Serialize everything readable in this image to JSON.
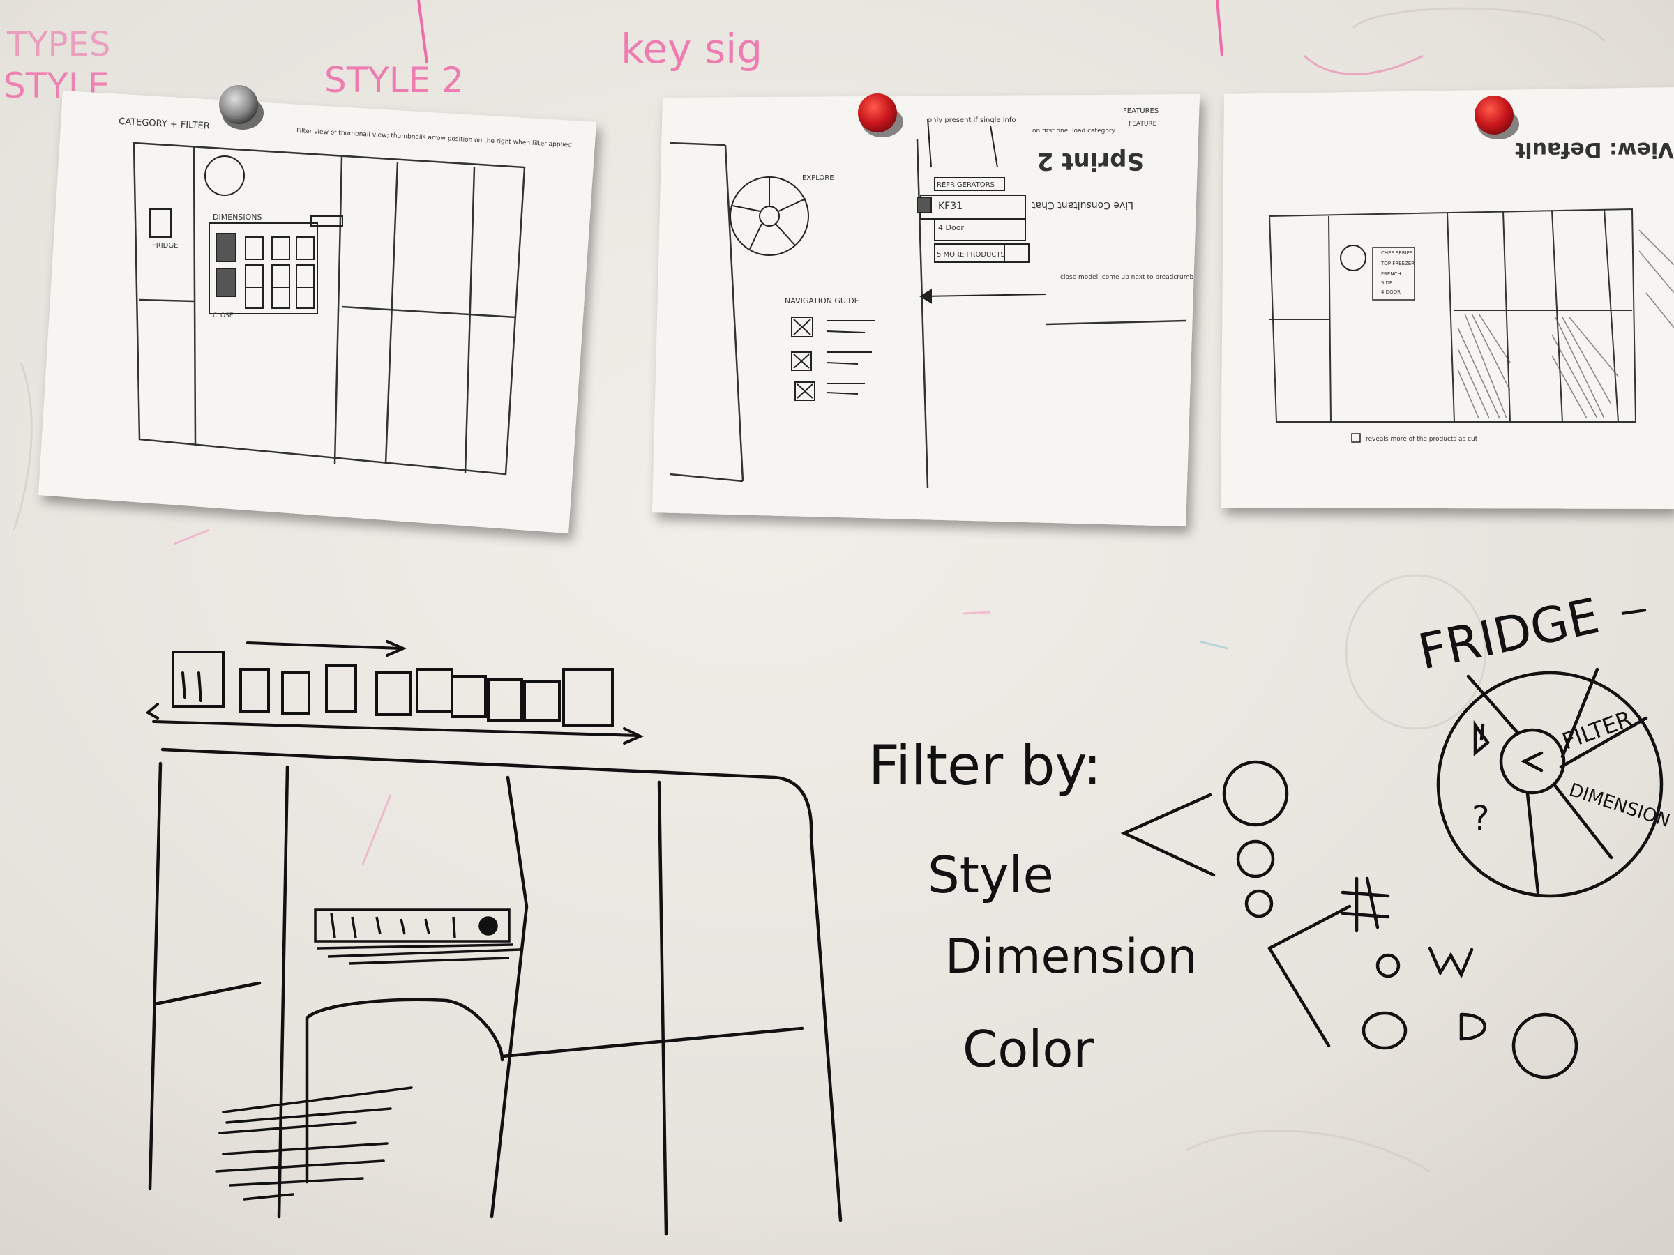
{
  "whiteboard": {
    "pink_scrawl": {
      "left_top": "TYPES",
      "left_mid": "STYLE",
      "style2": "STYLE 2",
      "keys": "key sig"
    },
    "fridge_label": "FRIDGE",
    "wheel": {
      "filter": "FILTER",
      "dimension": "DIMENSION",
      "question": "?"
    },
    "filter_by": {
      "heading": "Filter by:",
      "options": [
        "Style",
        "Dimension",
        "Color"
      ]
    }
  },
  "papers": {
    "left": {
      "header": "CATEGORY + FILTER",
      "note": "Filter view of thumbnail view; thumbnails arrow position on the right when filter applied",
      "dimensions_label": "DIMENSIONS",
      "fridge_label": "FRIDGE",
      "close_label": "CLOSE"
    },
    "middle": {
      "watermark": "Sprint 2",
      "watermark_sub": "Live Consultant Chat",
      "top_note": "only present if single info",
      "first_one_note": "on first one, load category",
      "features": "FEATURES",
      "feature_btn": "FEATURE",
      "explore": "EXPLORE",
      "refrigerators": "REFRIGERATORS",
      "item1": "KF31",
      "item2": "4 Door",
      "more_products": "5 MORE PRODUCTS",
      "nav_guide": "NAVIGATION GUIDE",
      "close_hint": "close model, come up next to breadcrumb"
    },
    "right": {
      "watermark": "View: Default",
      "chip1": "CHEF SERIES",
      "chip2": "TOP FREEZER",
      "chip3": "FRENCH",
      "chip4": "SIDE",
      "chip5": "4 DOOR",
      "footer_note": "reveals more of the products as cut"
    }
  },
  "colors": {
    "whiteboard": "#ece9e4",
    "marker_black": "#111111",
    "marker_pink": "#f06aa8",
    "magnet_red": "#c8161c",
    "magnet_gray": "#8a8a8a",
    "paper": "#f6f5f1"
  }
}
